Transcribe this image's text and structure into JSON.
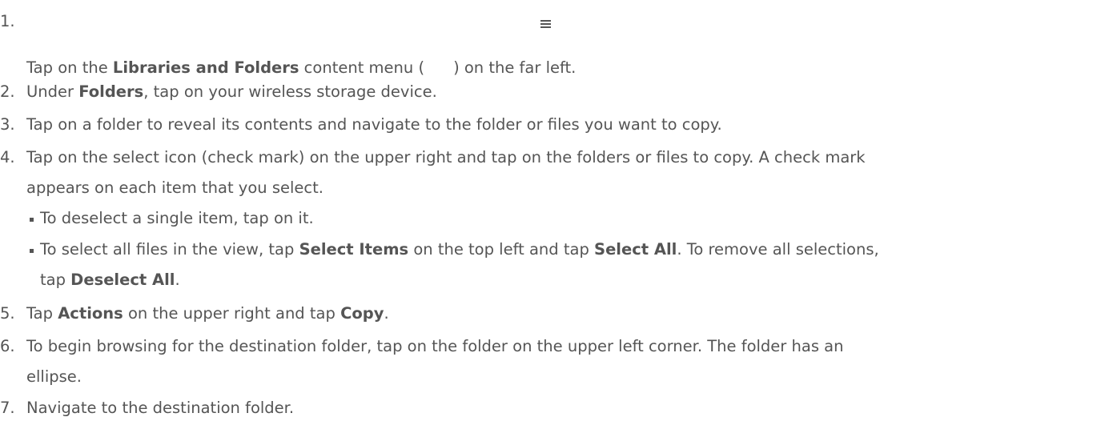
{
  "steps": [
    {
      "num": "1.",
      "parts": {
        "a": "Tap on the ",
        "b": "Libraries and Folders",
        "c": " content menu (",
        "d": ") on the far left."
      },
      "icon": "menu-icon"
    },
    {
      "num": "2.",
      "parts": {
        "a": "Under ",
        "b": "Folders",
        "c": ", tap on your wireless storage device."
      }
    },
    {
      "num": "3.",
      "text": "Tap on a folder to reveal its contents and navigate to the folder or files you want to copy."
    },
    {
      "num": "4.",
      "line1": "Tap on the select icon (check mark) on the upper right and tap on the folders or files to copy. A check mark",
      "line2": "appears on each item that you select.",
      "bullets": [
        {
          "text": "To deselect a single item, tap on it."
        },
        {
          "a": "To select all files in the view, tap ",
          "b": "Select Items",
          "c": " on the top left and tap ",
          "d": "Select All",
          "e": ". To remove all selections,",
          "f": "tap ",
          "g": "Deselect All",
          "h": "."
        }
      ]
    },
    {
      "num": "5.",
      "parts": {
        "a": "Tap ",
        "b": "Actions",
        "c": " on the upper right and tap ",
        "d": "Copy",
        "e": "."
      }
    },
    {
      "num": "6.",
      "line1": "To begin browsing for the destination folder, tap on the folder on the upper left corner. The folder has an",
      "line2": "ellipse."
    },
    {
      "num": "7.",
      "text": "Navigate to the destination folder."
    }
  ]
}
